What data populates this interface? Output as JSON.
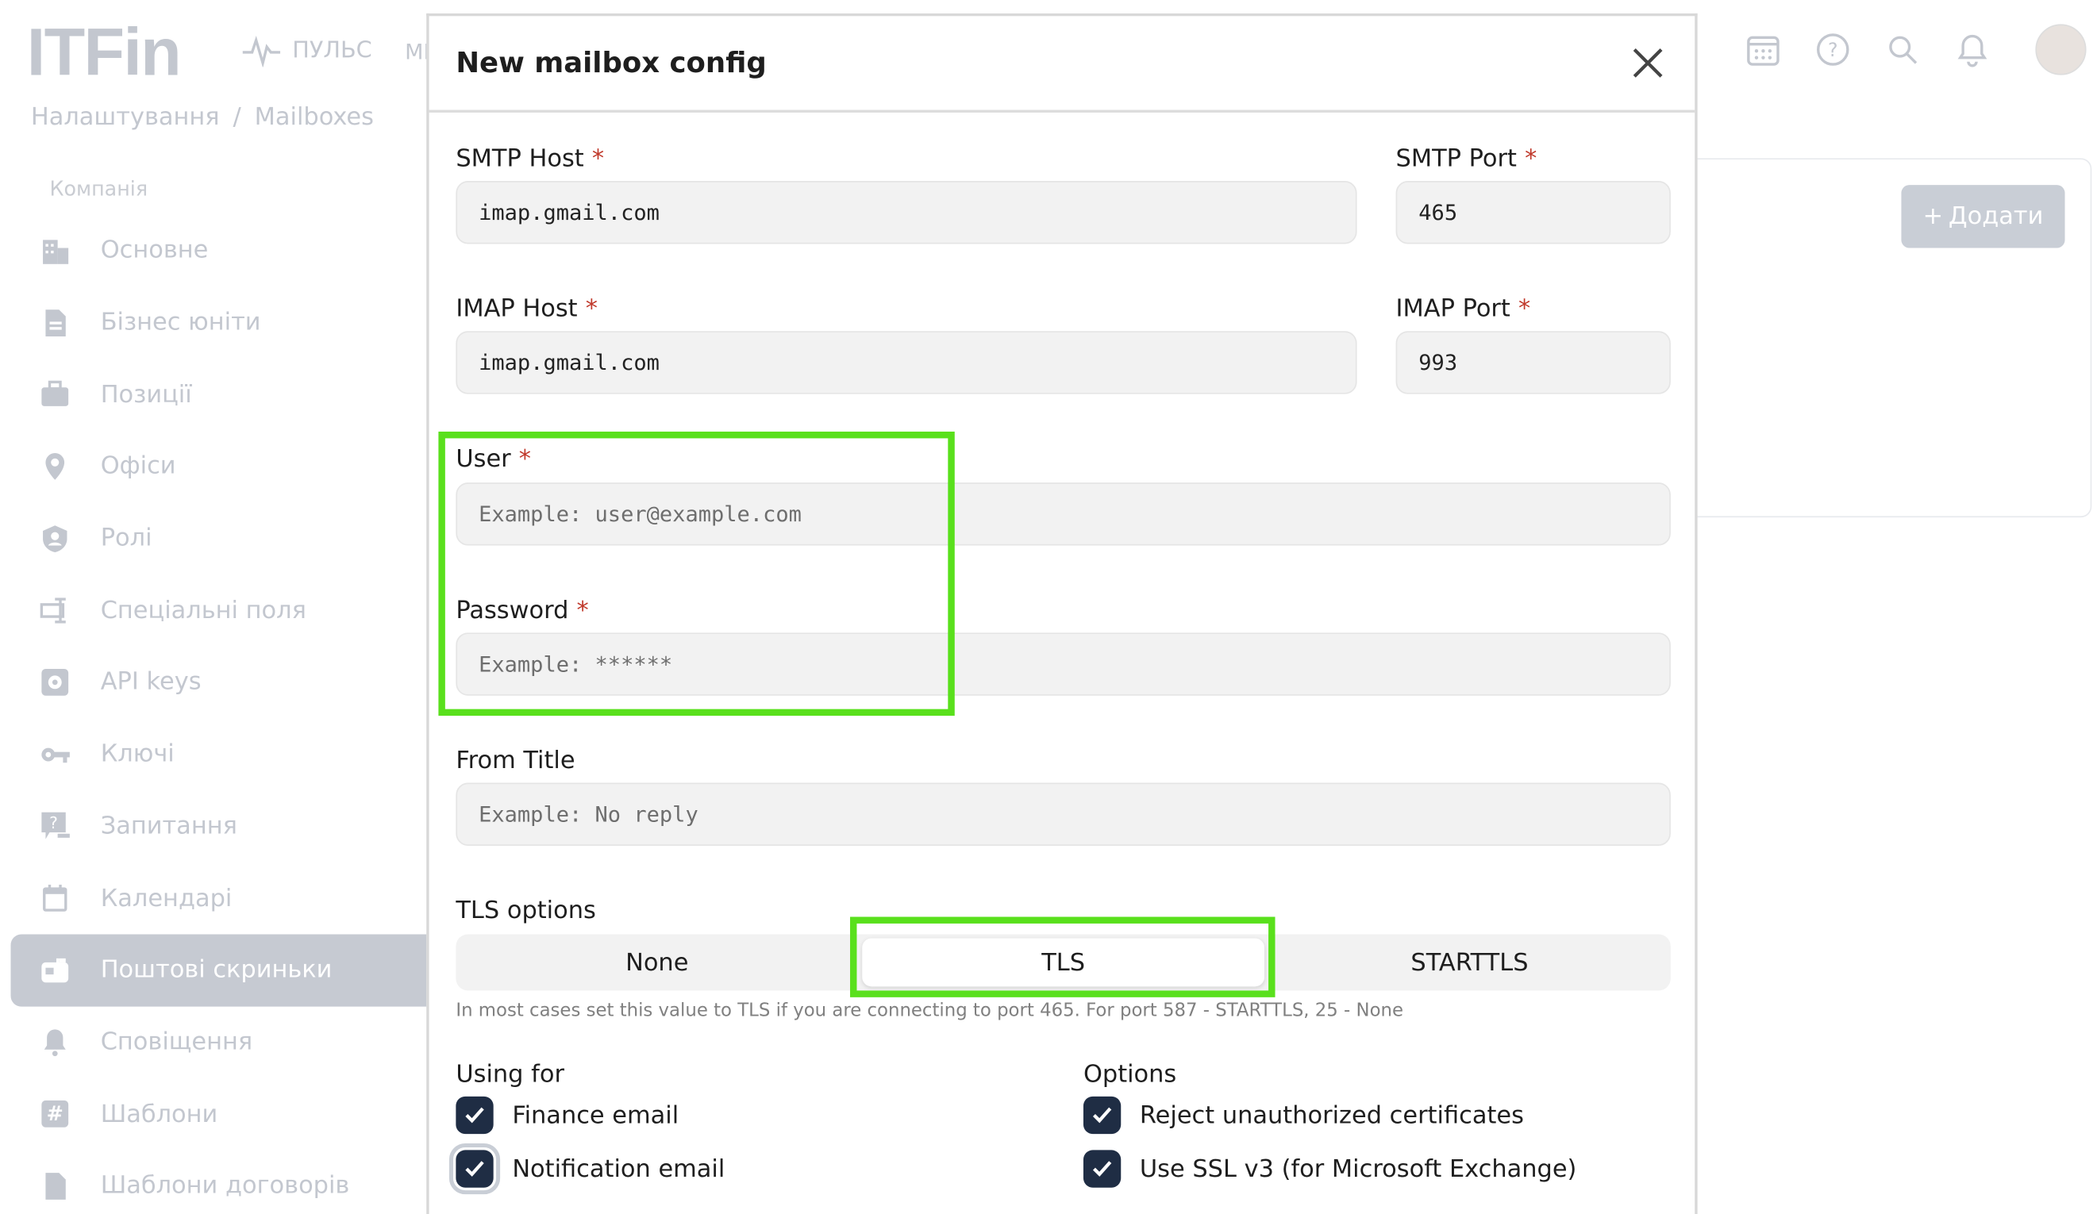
{
  "app": {
    "logo": "ITFin",
    "top_nav": {
      "pulse_label": "ПУЛЬС",
      "next_label": "МІ"
    },
    "breadcrumb": [
      "Налаштування",
      "Mailboxes"
    ],
    "breadcrumb_sep": "/",
    "sidebar": {
      "section": "Компанія",
      "items": [
        {
          "label": "Основне",
          "icon": "building-icon"
        },
        {
          "label": "Бізнес юніти",
          "icon": "document-icon"
        },
        {
          "label": "Позиції",
          "icon": "briefcase-icon"
        },
        {
          "label": "Офіси",
          "icon": "location-pin-icon"
        },
        {
          "label": "Ролі",
          "icon": "shield-user-icon"
        },
        {
          "label": "Спеціальні поля",
          "icon": "custom-field-icon"
        },
        {
          "label": "API keys",
          "icon": "gear-box-icon"
        },
        {
          "label": "Ключі",
          "icon": "key-icon"
        },
        {
          "label": "Запитання",
          "icon": "question-chat-icon"
        },
        {
          "label": "Календарі",
          "icon": "calendar-icon"
        },
        {
          "label": "Поштові скриньки",
          "icon": "mailbox-icon",
          "active": true
        },
        {
          "label": "Сповіщення",
          "icon": "bell-alert-icon"
        },
        {
          "label": "Шаблони",
          "icon": "hash-icon"
        },
        {
          "label": "Шаблони договорів",
          "icon": "file-icon"
        }
      ]
    },
    "add_button": "Додати"
  },
  "modal": {
    "title": "New mailbox config",
    "smtp_host": {
      "label": "SMTP Host",
      "required": "*",
      "value": "imap.gmail.com"
    },
    "smtp_port": {
      "label": "SMTP Port",
      "required": "*",
      "value": "465"
    },
    "imap_host": {
      "label": "IMAP Host",
      "required": "*",
      "value": "imap.gmail.com"
    },
    "imap_port": {
      "label": "IMAP Port",
      "required": "*",
      "value": "993"
    },
    "user": {
      "label": "User",
      "required": "*",
      "placeholder": "Example: user@example.com"
    },
    "password": {
      "label": "Password",
      "required": "*",
      "placeholder": "Example: ******"
    },
    "from_title": {
      "label": "From Title",
      "placeholder": "Example: No reply"
    },
    "tls": {
      "label": "TLS options",
      "options": [
        "None",
        "TLS",
        "STARTTLS"
      ],
      "selected": "TLS",
      "hint": "In most cases set this value to TLS if you are connecting to port 465. For port 587 - STARTTLS, 25 - None"
    },
    "using_for": {
      "title": "Using for",
      "items": [
        {
          "label": "Finance email",
          "checked": true
        },
        {
          "label": "Notification email",
          "checked": true
        }
      ]
    },
    "options": {
      "title": "Options",
      "items": [
        {
          "label": "Reject unauthorized certificates",
          "checked": true
        },
        {
          "label": "Use SSL v3 (for Microsoft Exchange)",
          "checked": true
        }
      ]
    }
  },
  "colors": {
    "highlight": "#59e01c",
    "checkbox": "#1f2d44",
    "required": "#c0392b"
  }
}
